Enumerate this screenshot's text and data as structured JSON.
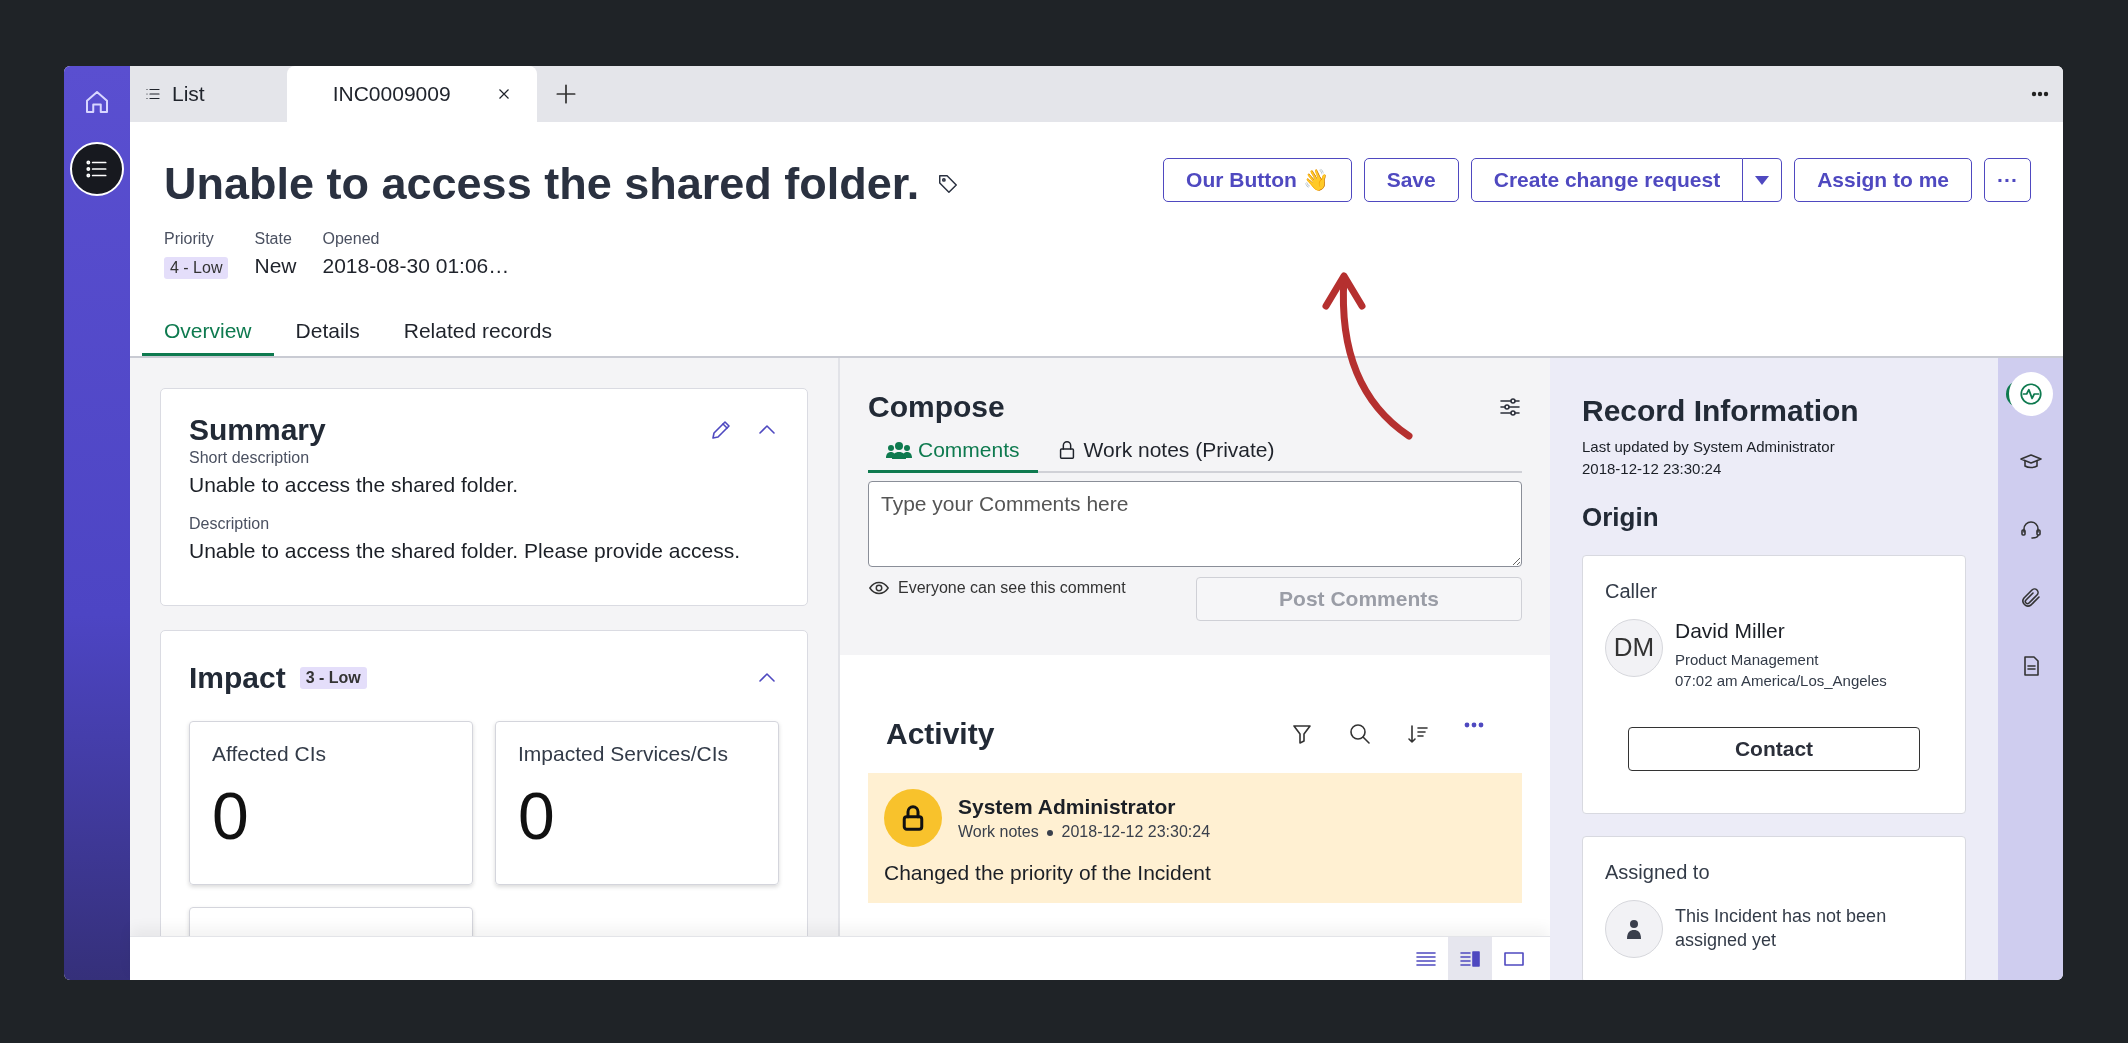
{
  "rail": {
    "items": [
      {
        "kind": "home",
        "selected": false
      },
      {
        "kind": "list",
        "selected": true
      }
    ]
  },
  "tabs": [
    {
      "label": "List",
      "selected": false,
      "closable": false
    },
    {
      "label": "INC0009009",
      "selected": true,
      "closable": true
    }
  ],
  "record": {
    "title": "Unable to access the shared folder.",
    "fields": [
      {
        "label": "Priority",
        "value": "4 - Low",
        "kind": "badge"
      },
      {
        "label": "State",
        "value": "New",
        "kind": "text"
      },
      {
        "label": "Opened",
        "value": "2018-08-30 01:06…",
        "kind": "text"
      }
    ]
  },
  "actions": [
    {
      "label": "Our Button 👋",
      "kind": "button"
    },
    {
      "label": "Save",
      "kind": "button"
    },
    {
      "label": "Create change request",
      "kind": "split"
    },
    {
      "label": "Assign to me",
      "kind": "button"
    },
    {
      "label": "···",
      "kind": "more"
    }
  ],
  "section_tabs": [
    {
      "label": "Overview",
      "selected": true
    },
    {
      "label": "Details",
      "selected": false
    },
    {
      "label": "Related records",
      "selected": false
    }
  ],
  "summary": {
    "title": "Summary",
    "fields": [
      {
        "label": "Short description",
        "value": "Unable to access the shared folder."
      },
      {
        "label": "Description",
        "value": "Unable to access the shared folder. Please provide access."
      }
    ]
  },
  "impact": {
    "title": "Impact",
    "badge": "3 - Low",
    "cards": [
      {
        "kind": "count",
        "label": "Affected CIs",
        "value": "0"
      },
      {
        "kind": "count",
        "label": "Impacted Services/CIs",
        "value": "0"
      },
      {
        "kind": "blank"
      }
    ]
  },
  "compose": {
    "title": "Compose",
    "tabs": [
      {
        "label": "Comments",
        "kind": "public",
        "selected": true
      },
      {
        "label": "Work notes (Private)",
        "kind": "private",
        "selected": false
      }
    ],
    "placeholder": "Type your Comments here",
    "note": "Everyone can see this comment",
    "post": {
      "label": "Post Comments",
      "disabled": true
    }
  },
  "activity": {
    "title": "Activity",
    "entries": [
      {
        "author": "System Administrator",
        "type": "Work notes",
        "time": "2018-12-12 23:30:24",
        "text": "Changed the priority of the Incident"
      }
    ]
  },
  "record_info": {
    "title": "Record Information",
    "updated_by": "Last updated by System Administrator",
    "updated_at": "2018-12-12 23:30:24",
    "origin_title": "Origin",
    "caller": {
      "heading": "Caller",
      "initials": "DM",
      "name": "David Miller",
      "department": "Product Management",
      "local_time": "07:02 am America/Los_Angeles",
      "button": "Contact"
    },
    "assigned": {
      "heading": "Assigned to",
      "text": "This Incident has not been assigned yet"
    }
  },
  "side_rail": [
    {
      "kind": "activity",
      "selected": true
    },
    {
      "kind": "learn",
      "selected": false
    },
    {
      "kind": "headset",
      "selected": false
    },
    {
      "kind": "attachment",
      "selected": false
    },
    {
      "kind": "document",
      "selected": false
    }
  ],
  "view_modes": [
    {
      "kind": "list",
      "selected": false
    },
    {
      "kind": "split",
      "selected": true
    },
    {
      "kind": "single",
      "selected": false
    }
  ]
}
